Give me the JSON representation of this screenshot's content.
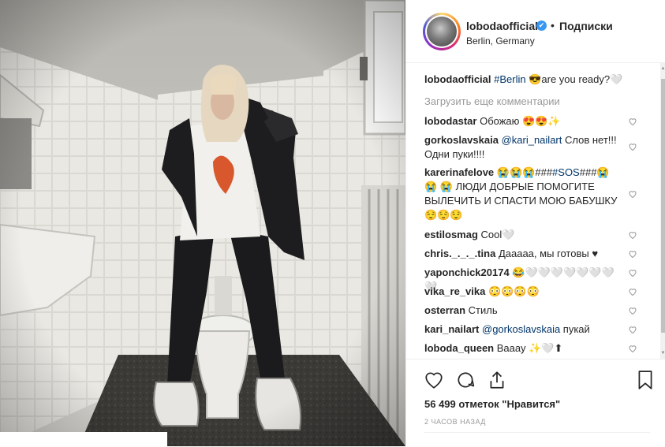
{
  "header": {
    "username": "lobodaofficial",
    "verified_mark": "✔",
    "separator": "•",
    "follow_status": "Подписки",
    "location": "Berlin, Germany"
  },
  "caption": {
    "username": "lobodaofficial",
    "hashtag": "#Berlin",
    "text": " 😎are you ready?🤍"
  },
  "load_more": "Загрузить еще комментарии",
  "comments": [
    {
      "user": "lobodastar",
      "pre": "",
      "tag": "",
      "text": "Обожаю 😍😍✨"
    },
    {
      "user": "gorkoslavskaia",
      "pre": "",
      "tag": "@kari_nailart",
      "text": " Слов нет!!! Одни пуки!!!!"
    },
    {
      "user": "karerinafelove",
      "pre": "😭😭😭###",
      "tag": "#SOS",
      "text": "###😭😭 😭 ЛЮДИ ДОБРЫЕ ПОМОГИТЕ ВЫЛЕЧИТЬ И СПАСТИ МОЮ БАБУШКУ😌😌😌"
    },
    {
      "user": "estilosmag",
      "pre": "",
      "tag": "",
      "text": "Cool🤍"
    },
    {
      "user": "chris._._._.tina",
      "pre": "",
      "tag": "",
      "text": "Дааааа, мы готовы ♥"
    },
    {
      "user": "yaponchick20174",
      "pre": "",
      "tag": "",
      "text": "😂🤍🤍🤍🤍🤍🤍🤍🤍"
    },
    {
      "user": "vika_re_vika",
      "pre": "",
      "tag": "",
      "text": "😳😳😳😳"
    },
    {
      "user": "osterran",
      "pre": "",
      "tag": "",
      "text": "Стиль"
    },
    {
      "user": "kari_nailart",
      "pre": "",
      "tag": "@gorkoslavskaia",
      "text": " пукай"
    },
    {
      "user": "loboda_queen",
      "pre": "",
      "tag": "",
      "text": "Вааау ✨🤍⬆"
    }
  ],
  "likes": "56 499 отметок \"Нравится\"",
  "timestamp": "2 ЧАСОВ НАЗАД",
  "icons": {
    "like": "heart-icon",
    "comment": "comment-bubble-icon",
    "share": "share-icon",
    "save": "bookmark-icon"
  },
  "colors": {
    "link": "#003569",
    "verified": "#3897f0",
    "muted": "#999999"
  }
}
